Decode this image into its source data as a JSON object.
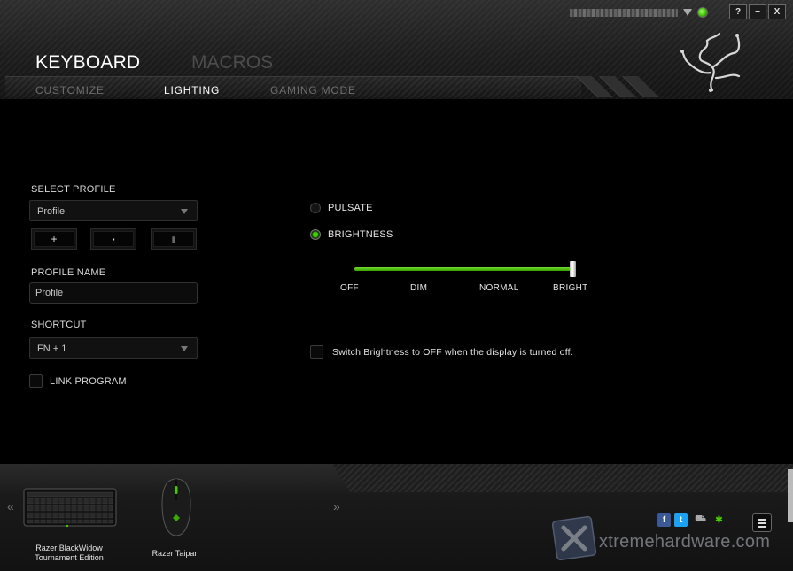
{
  "window": {
    "account_obscured": true,
    "help_label": "?",
    "minimize_label": "−",
    "close_label": "X"
  },
  "header": {
    "title": "KEYBOARD",
    "secondary_tab": "MACROS",
    "subtabs": [
      {
        "label": "CUSTOMIZE",
        "active": false
      },
      {
        "label": "LIGHTING",
        "active": true
      },
      {
        "label": "GAMING MODE",
        "active": false
      }
    ]
  },
  "profile": {
    "select_label": "SELECT PROFILE",
    "selected": "Profile",
    "add_label": "+",
    "copy_label": "▪",
    "delete_label": "▮",
    "name_label": "PROFILE NAME",
    "name_value": "Profile",
    "shortcut_label": "SHORTCUT",
    "shortcut_value": "FN + 1",
    "link_program_label": "LINK PROGRAM",
    "link_program_checked": false
  },
  "lighting": {
    "effects": [
      {
        "label": "PULSATE",
        "selected": false
      },
      {
        "label": "BRIGHTNESS",
        "selected": true
      }
    ],
    "brightness": {
      "levels": [
        "OFF",
        "DIM",
        "NORMAL",
        "BRIGHT"
      ],
      "value_fraction": 1.0
    },
    "display_off_label": "Switch Brightness to OFF when the display is turned off.",
    "display_off_checked": false
  },
  "footer": {
    "prev_label": "«",
    "next_label": "»",
    "devices": [
      {
        "name_line1": "Razer BlackWidow",
        "name_line2": "Tournament Edition"
      },
      {
        "name_line1": "Razer Taipan",
        "name_line2": ""
      }
    ],
    "social": [
      "facebook-icon",
      "twitter-icon",
      "store-icon",
      "razer-icon"
    ],
    "watermark": "xtremehardware.com"
  },
  "colors": {
    "accent": "#44cc00",
    "background": "#000000",
    "inactive_text": "#4c4c4c"
  }
}
